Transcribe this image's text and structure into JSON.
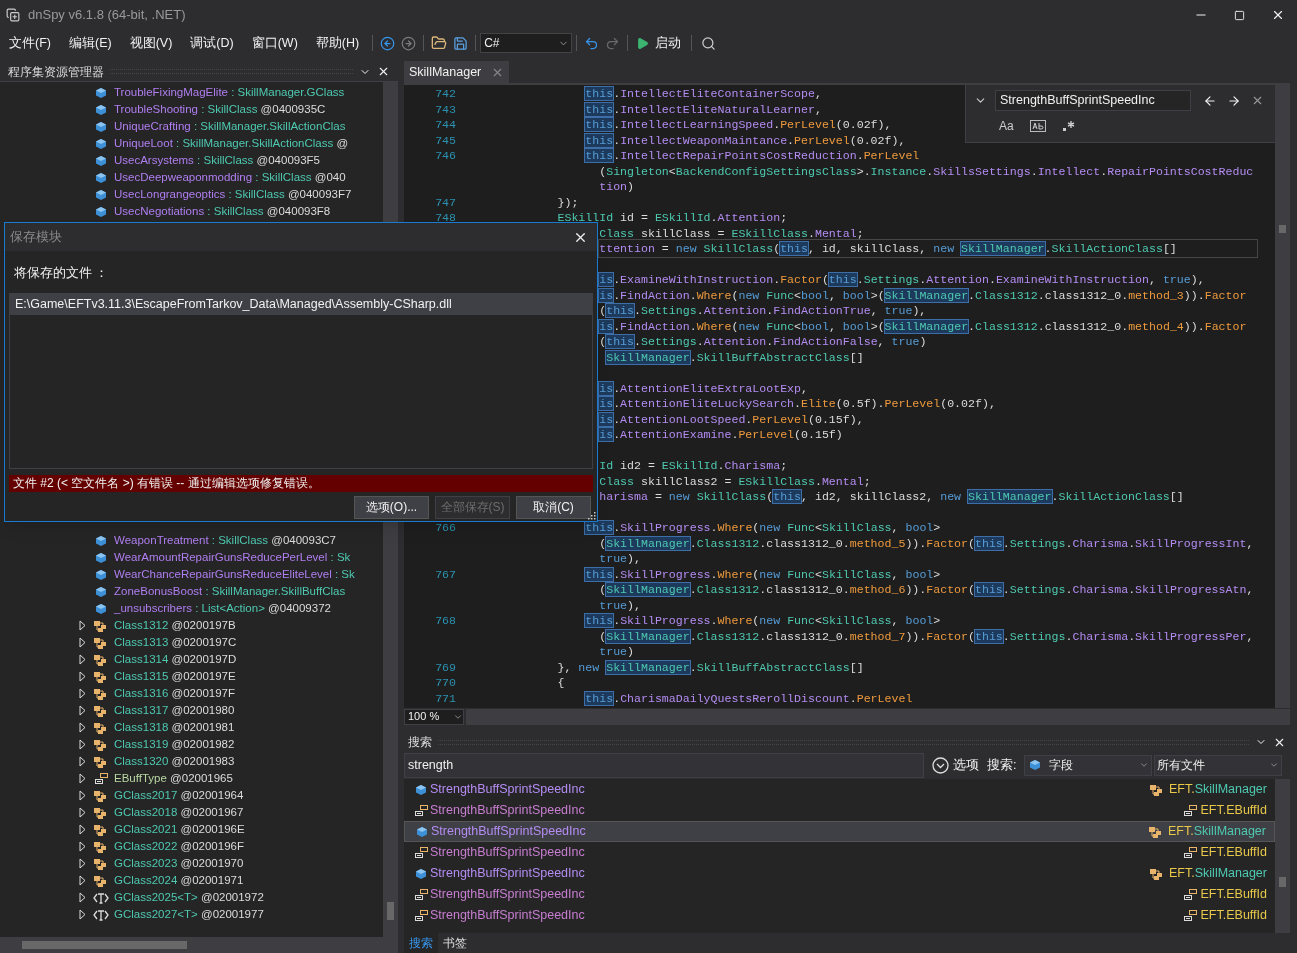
{
  "window": {
    "title": "dnSpy v6.1.8 (64-bit, .NET)"
  },
  "menu": [
    "文件(F)",
    "编辑(E)",
    "视图(V)",
    "调试(D)",
    "窗口(W)",
    "帮助(H)"
  ],
  "toolbar": {
    "language": "C#",
    "run_label": "启动"
  },
  "assembly_explorer": {
    "title": "程序集资源管理器",
    "items_top": [
      {
        "kind": "field",
        "name": "TroubleFixingMagElite",
        "type": ": SkillManager.GClass"
      },
      {
        "kind": "field",
        "name": "TroubleShooting",
        "type": ": SkillClass",
        "token": "@0400935C"
      },
      {
        "kind": "field",
        "name": "UniqueCrafting",
        "type": ": SkillManager.SkillActionClas"
      },
      {
        "kind": "field",
        "name": "UniqueLoot",
        "type": ": SkillManager.SkillActionClass",
        "token": "@"
      },
      {
        "kind": "field",
        "name": "UsecArsystems",
        "type": ": SkillClass",
        "token": "@040093F5"
      },
      {
        "kind": "field",
        "name": "UsecDeepweaponmodding",
        "type": ": SkillClass",
        "token": "@040"
      },
      {
        "kind": "field",
        "name": "UsecLongrangeoptics",
        "type": ": SkillClass",
        "token": "@040093F7"
      },
      {
        "kind": "field",
        "name": "UsecNegotiations",
        "type": ": SkillClass",
        "token": "@040093F8"
      }
    ],
    "items_bottom": [
      {
        "kind": "field",
        "name": "WeaponTreatment",
        "type": ": SkillClass",
        "token": "@040093C7"
      },
      {
        "kind": "field",
        "name": "WearAmountRepairGunsReducePerLevel",
        "type": ": Sk"
      },
      {
        "kind": "field",
        "name": "WearChanceRepairGunsReduceEliteLevel",
        "type": ": Sk"
      },
      {
        "kind": "field",
        "name": "ZoneBonusBoost",
        "type": ": SkillManager.SkillBuffClas"
      },
      {
        "kind": "field",
        "name": "_unsubscribers",
        "type": ": List<Action>",
        "token": "@04009372"
      },
      {
        "kind": "class",
        "name": "Class1312",
        "token": "@0200197B",
        "expanded": false
      },
      {
        "kind": "class",
        "name": "Class1313",
        "token": "@0200197C",
        "expanded": false
      },
      {
        "kind": "class",
        "name": "Class1314",
        "token": "@0200197D",
        "expanded": false
      },
      {
        "kind": "class",
        "name": "Class1315",
        "token": "@0200197E",
        "expanded": false
      },
      {
        "kind": "class",
        "name": "Class1316",
        "token": "@0200197F",
        "expanded": false
      },
      {
        "kind": "class",
        "name": "Class1317",
        "token": "@02001980",
        "expanded": false
      },
      {
        "kind": "class",
        "name": "Class1318",
        "token": "@02001981",
        "expanded": false
      },
      {
        "kind": "class",
        "name": "Class1319",
        "token": "@02001982",
        "expanded": false
      },
      {
        "kind": "class",
        "name": "Class1320",
        "token": "@02001983",
        "expanded": false
      },
      {
        "kind": "enum",
        "name": "EBuffType",
        "token": "@02001965",
        "expanded": false
      },
      {
        "kind": "class",
        "name": "GClass2017",
        "token": "@02001964",
        "expanded": false
      },
      {
        "kind": "class",
        "name": "GClass2018",
        "token": "@02001967",
        "expanded": false
      },
      {
        "kind": "class",
        "name": "GClass2021",
        "token": "@0200196E",
        "expanded": false
      },
      {
        "kind": "class",
        "name": "GClass2022",
        "token": "@0200196F",
        "expanded": false
      },
      {
        "kind": "class",
        "name": "GClass2023",
        "token": "@02001970",
        "expanded": false
      },
      {
        "kind": "class",
        "name": "GClass2024",
        "token": "@02001971",
        "expanded": false
      },
      {
        "kind": "generic",
        "name": "GClass2025<T>",
        "token": "@02001972",
        "expanded": false
      },
      {
        "kind": "generic",
        "name": "GClass2027<T>",
        "token": "@02001977",
        "expanded": false
      }
    ]
  },
  "editor": {
    "tab": {
      "label": "SkillManager",
      "selected": true
    },
    "find": {
      "query": "StrengthBuffSprintSpeedInc",
      "options": [
        {
          "kind": "case",
          "label": "Aa",
          "on": false
        },
        {
          "kind": "word",
          "on": false
        },
        {
          "kind": "regex",
          "on": false
        }
      ]
    },
    "zoom": "100 %",
    "lines": [
      {
        "kind": "inner",
        "number": "742",
        "current": false,
        "tokens": [
          {
            "kind": "this",
            "text": "this"
          },
          {
            "kind": "plain",
            "text": "."
          },
          {
            "kind": "member",
            "text": "IntellectEliteContainerScope"
          },
          {
            "kind": "plain",
            "text": ","
          }
        ]
      },
      {
        "kind": "inner",
        "number": "743",
        "current": false,
        "tokens": [
          {
            "kind": "this",
            "text": "this"
          },
          {
            "kind": "plain",
            "text": "."
          },
          {
            "kind": "member",
            "text": "IntellectEliteNaturalLearner"
          },
          {
            "kind": "plain",
            "text": ","
          }
        ]
      },
      {
        "kind": "inner",
        "number": "744",
        "current": false,
        "tokens": [
          {
            "kind": "this",
            "text": "this"
          },
          {
            "kind": "plain",
            "text": "."
          },
          {
            "kind": "member",
            "text": "IntellectLearningSpeed"
          },
          {
            "kind": "plain",
            "text": "."
          },
          {
            "kind": "method",
            "text": "PerLevel"
          },
          {
            "kind": "plain",
            "text": "(0.02f),"
          }
        ]
      },
      {
        "kind": "inner",
        "number": "745",
        "current": false,
        "tokens": [
          {
            "kind": "this",
            "text": "this"
          },
          {
            "kind": "plain",
            "text": "."
          },
          {
            "kind": "member",
            "text": "IntellectWeaponMaintance"
          },
          {
            "kind": "plain",
            "text": "."
          },
          {
            "kind": "method",
            "text": "PerLevel"
          },
          {
            "kind": "plain",
            "text": "(0.02f),"
          }
        ]
      },
      {
        "kind": "inner",
        "number": "746",
        "current": false,
        "tokens": [
          {
            "kind": "this",
            "text": "this"
          },
          {
            "kind": "plain",
            "text": "."
          },
          {
            "kind": "member",
            "text": "IntellectRepairPointsCostReduction"
          },
          {
            "kind": "plain",
            "text": "."
          },
          {
            "kind": "method",
            "text": "PerLevel"
          }
        ]
      },
      {
        "kind": "wrap",
        "current": false,
        "tokens": [
          {
            "kind": "plain",
            "text": "("
          },
          {
            "kind": "type",
            "text": "Singleton"
          },
          {
            "kind": "plain",
            "text": "<"
          },
          {
            "kind": "type",
            "text": "BackendConfigSettingsClass"
          },
          {
            "kind": "plain",
            "text": ">."
          },
          {
            "kind": "type",
            "text": "Instance"
          },
          {
            "kind": "plain",
            "text": "."
          },
          {
            "kind": "member",
            "text": "SkillsSettings"
          },
          {
            "kind": "plain",
            "text": "."
          },
          {
            "kind": "member",
            "text": "Intellect"
          },
          {
            "kind": "plain",
            "text": "."
          },
          {
            "kind": "member",
            "text": "RepairPointsCostReduc"
          }
        ]
      },
      {
        "kind": "wrap",
        "current": false,
        "tokens": [
          {
            "kind": "member",
            "text": "tion"
          },
          {
            "kind": "plain",
            "text": ")"
          }
        ]
      },
      {
        "kind": "outer",
        "number": "747",
        "current": false,
        "tokens": [
          {
            "kind": "plain",
            "text": "});"
          }
        ]
      },
      {
        "kind": "outer",
        "number": "748",
        "current": false,
        "tokens": [
          {
            "kind": "type",
            "text": "ESkillId"
          },
          {
            "kind": "plain",
            "text": " id = "
          },
          {
            "kind": "type",
            "text": "ESkillId"
          },
          {
            "kind": "plain",
            "text": "."
          },
          {
            "kind": "member",
            "text": "Attention"
          },
          {
            "kind": "plain",
            "text": ";"
          }
        ]
      },
      {
        "kind": "wrap",
        "current": false,
        "tokens": [
          {
            "kind": "type",
            "text": "Class"
          },
          {
            "kind": "plain",
            "text": " skillClass = "
          },
          {
            "kind": "type",
            "text": "ESkillClass"
          },
          {
            "kind": "plain",
            "text": "."
          },
          {
            "kind": "member",
            "text": "Mental"
          },
          {
            "kind": "plain",
            "text": ";"
          }
        ]
      },
      {
        "kind": "wrap",
        "current": true,
        "tokens": [
          {
            "kind": "member",
            "text": "ttention"
          },
          {
            "kind": "plain",
            "text": " = "
          },
          {
            "kind": "keyword",
            "text": "new "
          },
          {
            "kind": "type",
            "text": "SkillClass"
          },
          {
            "kind": "plain",
            "text": "("
          },
          {
            "kind": "this",
            "text": "this"
          },
          {
            "kind": "plain",
            "text": ", id, skillClass, "
          },
          {
            "kind": "keyword",
            "text": "new "
          },
          {
            "kind": "typeref",
            "text": "SkillManager"
          },
          {
            "kind": "plain",
            "text": "."
          },
          {
            "kind": "type",
            "text": "SkillActionClass"
          },
          {
            "kind": "plain",
            "text": "[]"
          }
        ]
      },
      {
        "kind": "blank"
      },
      {
        "kind": "wrap",
        "current": false,
        "tokens": [
          {
            "kind": "this",
            "text": "is"
          },
          {
            "kind": "plain",
            "text": "."
          },
          {
            "kind": "member",
            "text": "ExamineWithInstruction"
          },
          {
            "kind": "plain",
            "text": "."
          },
          {
            "kind": "method",
            "text": "Factor"
          },
          {
            "kind": "plain",
            "text": "("
          },
          {
            "kind": "this",
            "text": "this"
          },
          {
            "kind": "plain",
            "text": "."
          },
          {
            "kind": "type",
            "text": "Settings"
          },
          {
            "kind": "plain",
            "text": "."
          },
          {
            "kind": "member",
            "text": "Attention"
          },
          {
            "kind": "plain",
            "text": "."
          },
          {
            "kind": "member",
            "text": "ExamineWithInstruction"
          },
          {
            "kind": "plain",
            "text": ", "
          },
          {
            "kind": "keyword",
            "text": "true"
          },
          {
            "kind": "plain",
            "text": "),"
          }
        ]
      },
      {
        "kind": "wrap",
        "current": false,
        "tokens": [
          {
            "kind": "this",
            "text": "is"
          },
          {
            "kind": "plain",
            "text": "."
          },
          {
            "kind": "member",
            "text": "FindAction"
          },
          {
            "kind": "plain",
            "text": "."
          },
          {
            "kind": "method",
            "text": "Where"
          },
          {
            "kind": "plain",
            "text": "("
          },
          {
            "kind": "keyword",
            "text": "new "
          },
          {
            "kind": "type",
            "text": "Func"
          },
          {
            "kind": "plain",
            "text": "<"
          },
          {
            "kind": "keyword",
            "text": "bool"
          },
          {
            "kind": "plain",
            "text": ", "
          },
          {
            "kind": "keyword",
            "text": "bool"
          },
          {
            "kind": "plain",
            "text": ">("
          },
          {
            "kind": "typeref",
            "text": "SkillManager"
          },
          {
            "kind": "plain",
            "text": "."
          },
          {
            "kind": "type",
            "text": "Class1312"
          },
          {
            "kind": "plain",
            "text": ".class1312_0."
          },
          {
            "kind": "method",
            "text": "method_3"
          },
          {
            "kind": "plain",
            "text": "))."
          },
          {
            "kind": "method",
            "text": "Factor"
          }
        ]
      },
      {
        "kind": "wrap",
        "current": false,
        "tokens": [
          {
            "kind": "plain",
            "text": "("
          },
          {
            "kind": "this",
            "text": "this"
          },
          {
            "kind": "plain",
            "text": "."
          },
          {
            "kind": "type",
            "text": "Settings"
          },
          {
            "kind": "plain",
            "text": "."
          },
          {
            "kind": "member",
            "text": "Attention"
          },
          {
            "kind": "plain",
            "text": "."
          },
          {
            "kind": "member",
            "text": "FindActionTrue"
          },
          {
            "kind": "plain",
            "text": ", "
          },
          {
            "kind": "keyword",
            "text": "true"
          },
          {
            "kind": "plain",
            "text": "),"
          }
        ]
      },
      {
        "kind": "wrap",
        "current": false,
        "tokens": [
          {
            "kind": "this",
            "text": "is"
          },
          {
            "kind": "plain",
            "text": "."
          },
          {
            "kind": "member",
            "text": "FindAction"
          },
          {
            "kind": "plain",
            "text": "."
          },
          {
            "kind": "method",
            "text": "Where"
          },
          {
            "kind": "plain",
            "text": "("
          },
          {
            "kind": "keyword",
            "text": "new "
          },
          {
            "kind": "type",
            "text": "Func"
          },
          {
            "kind": "plain",
            "text": "<"
          },
          {
            "kind": "keyword",
            "text": "bool"
          },
          {
            "kind": "plain",
            "text": ", "
          },
          {
            "kind": "keyword",
            "text": "bool"
          },
          {
            "kind": "plain",
            "text": ">("
          },
          {
            "kind": "typeref",
            "text": "SkillManager"
          },
          {
            "kind": "plain",
            "text": "."
          },
          {
            "kind": "type",
            "text": "Class1312"
          },
          {
            "kind": "plain",
            "text": ".class1312_0."
          },
          {
            "kind": "method",
            "text": "method_4"
          },
          {
            "kind": "plain",
            "text": "))."
          },
          {
            "kind": "method",
            "text": "Factor"
          }
        ]
      },
      {
        "kind": "wrap",
        "current": false,
        "tokens": [
          {
            "kind": "plain",
            "text": "("
          },
          {
            "kind": "this",
            "text": "this"
          },
          {
            "kind": "plain",
            "text": "."
          },
          {
            "kind": "type",
            "text": "Settings"
          },
          {
            "kind": "plain",
            "text": "."
          },
          {
            "kind": "member",
            "text": "Attention"
          },
          {
            "kind": "plain",
            "text": "."
          },
          {
            "kind": "member",
            "text": "FindActionFalse"
          },
          {
            "kind": "plain",
            "text": ", "
          },
          {
            "kind": "keyword",
            "text": "true"
          },
          {
            "kind": "plain",
            "text": ")"
          }
        ]
      },
      {
        "kind": "wrap_extra",
        "current": false,
        "tokens": [
          {
            "kind": "typeref",
            "text": "SkillManager"
          },
          {
            "kind": "plain",
            "text": "."
          },
          {
            "kind": "type",
            "text": "SkillBuffAbstractClass"
          },
          {
            "kind": "plain",
            "text": "[]"
          }
        ]
      },
      {
        "kind": "blank"
      },
      {
        "kind": "wrap",
        "current": false,
        "tokens": [
          {
            "kind": "this",
            "text": "is"
          },
          {
            "kind": "plain",
            "text": "."
          },
          {
            "kind": "member",
            "text": "AttentionEliteExtraLootExp"
          },
          {
            "kind": "plain",
            "text": ","
          }
        ]
      },
      {
        "kind": "wrap",
        "current": false,
        "tokens": [
          {
            "kind": "this",
            "text": "is"
          },
          {
            "kind": "plain",
            "text": "."
          },
          {
            "kind": "member",
            "text": "AttentionEliteLuckySearch"
          },
          {
            "kind": "plain",
            "text": "."
          },
          {
            "kind": "method",
            "text": "Elite"
          },
          {
            "kind": "plain",
            "text": "(0.5f)."
          },
          {
            "kind": "method",
            "text": "PerLevel"
          },
          {
            "kind": "plain",
            "text": "(0.02f),"
          }
        ]
      },
      {
        "kind": "wrap",
        "current": false,
        "tokens": [
          {
            "kind": "this",
            "text": "is"
          },
          {
            "kind": "plain",
            "text": "."
          },
          {
            "kind": "member",
            "text": "AttentionLootSpeed"
          },
          {
            "kind": "plain",
            "text": "."
          },
          {
            "kind": "method",
            "text": "PerLevel"
          },
          {
            "kind": "plain",
            "text": "(0.15f),"
          }
        ]
      },
      {
        "kind": "wrap",
        "current": false,
        "tokens": [
          {
            "kind": "this",
            "text": "is"
          },
          {
            "kind": "plain",
            "text": "."
          },
          {
            "kind": "member",
            "text": "AttentionExamine"
          },
          {
            "kind": "plain",
            "text": "."
          },
          {
            "kind": "method",
            "text": "PerLevel"
          },
          {
            "kind": "plain",
            "text": "(0.15f)"
          }
        ]
      },
      {
        "kind": "blank"
      },
      {
        "kind": "wrap",
        "current": false,
        "tokens": [
          {
            "kind": "type",
            "text": "Id"
          },
          {
            "kind": "plain",
            "text": " id2 = "
          },
          {
            "kind": "type",
            "text": "ESkillId"
          },
          {
            "kind": "plain",
            "text": "."
          },
          {
            "kind": "member",
            "text": "Charisma"
          },
          {
            "kind": "plain",
            "text": ";"
          }
        ]
      },
      {
        "kind": "wrap",
        "current": false,
        "tokens": [
          {
            "kind": "type",
            "text": "Class"
          },
          {
            "kind": "plain",
            "text": " skillClass2 = "
          },
          {
            "kind": "type",
            "text": "ESkillClass"
          },
          {
            "kind": "plain",
            "text": "."
          },
          {
            "kind": "member",
            "text": "Mental"
          },
          {
            "kind": "plain",
            "text": ";"
          }
        ]
      },
      {
        "kind": "wrap",
        "current": false,
        "tokens": [
          {
            "kind": "member",
            "text": "harisma"
          },
          {
            "kind": "plain",
            "text": " = "
          },
          {
            "kind": "keyword",
            "text": "new "
          },
          {
            "kind": "type",
            "text": "SkillClass"
          },
          {
            "kind": "plain",
            "text": "("
          },
          {
            "kind": "this",
            "text": "this"
          },
          {
            "kind": "plain",
            "text": ", id2, skillClass2, "
          },
          {
            "kind": "keyword",
            "text": "new "
          },
          {
            "kind": "typeref",
            "text": "SkillManager"
          },
          {
            "kind": "plain",
            "text": "."
          },
          {
            "kind": "type",
            "text": "SkillActionClass"
          },
          {
            "kind": "plain",
            "text": "[]"
          }
        ]
      },
      {
        "kind": "blank"
      },
      {
        "kind": "inner",
        "number": "766",
        "current": false,
        "tokens": [
          {
            "kind": "this",
            "text": "this"
          },
          {
            "kind": "plain",
            "text": "."
          },
          {
            "kind": "member",
            "text": "SkillProgress"
          },
          {
            "kind": "plain",
            "text": "."
          },
          {
            "kind": "method",
            "text": "Where"
          },
          {
            "kind": "plain",
            "text": "("
          },
          {
            "kind": "keyword",
            "text": "new "
          },
          {
            "kind": "type",
            "text": "Func"
          },
          {
            "kind": "plain",
            "text": "<"
          },
          {
            "kind": "type",
            "text": "SkillClass"
          },
          {
            "kind": "plain",
            "text": ", "
          },
          {
            "kind": "keyword",
            "text": "bool"
          },
          {
            "kind": "plain",
            "text": ">"
          }
        ]
      },
      {
        "kind": "wrap",
        "current": false,
        "tokens": [
          {
            "kind": "plain",
            "text": "("
          },
          {
            "kind": "typeref",
            "text": "SkillManager"
          },
          {
            "kind": "plain",
            "text": "."
          },
          {
            "kind": "type",
            "text": "Class1312"
          },
          {
            "kind": "plain",
            "text": ".class1312_0."
          },
          {
            "kind": "method",
            "text": "method_5"
          },
          {
            "kind": "plain",
            "text": "))."
          },
          {
            "kind": "method",
            "text": "Factor"
          },
          {
            "kind": "plain",
            "text": "("
          },
          {
            "kind": "this",
            "text": "this"
          },
          {
            "kind": "plain",
            "text": "."
          },
          {
            "kind": "type",
            "text": "Settings"
          },
          {
            "kind": "plain",
            "text": "."
          },
          {
            "kind": "member",
            "text": "Charisma"
          },
          {
            "kind": "plain",
            "text": "."
          },
          {
            "kind": "member",
            "text": "SkillProgressInt"
          },
          {
            "kind": "plain",
            "text": ","
          }
        ]
      },
      {
        "kind": "wrap",
        "current": false,
        "tokens": [
          {
            "kind": "keyword",
            "text": "true"
          },
          {
            "kind": "plain",
            "text": "),"
          }
        ]
      },
      {
        "kind": "inner",
        "number": "767",
        "current": false,
        "tokens": [
          {
            "kind": "this",
            "text": "this"
          },
          {
            "kind": "plain",
            "text": "."
          },
          {
            "kind": "member",
            "text": "SkillProgress"
          },
          {
            "kind": "plain",
            "text": "."
          },
          {
            "kind": "method",
            "text": "Where"
          },
          {
            "kind": "plain",
            "text": "("
          },
          {
            "kind": "keyword",
            "text": "new "
          },
          {
            "kind": "type",
            "text": "Func"
          },
          {
            "kind": "plain",
            "text": "<"
          },
          {
            "kind": "type",
            "text": "SkillClass"
          },
          {
            "kind": "plain",
            "text": ", "
          },
          {
            "kind": "keyword",
            "text": "bool"
          },
          {
            "kind": "plain",
            "text": ">"
          }
        ]
      },
      {
        "kind": "wrap",
        "current": false,
        "tokens": [
          {
            "kind": "plain",
            "text": "("
          },
          {
            "kind": "typeref",
            "text": "SkillManager"
          },
          {
            "kind": "plain",
            "text": "."
          },
          {
            "kind": "type",
            "text": "Class1312"
          },
          {
            "kind": "plain",
            "text": ".class1312_0."
          },
          {
            "kind": "method",
            "text": "method_6"
          },
          {
            "kind": "plain",
            "text": "))."
          },
          {
            "kind": "method",
            "text": "Factor"
          },
          {
            "kind": "plain",
            "text": "("
          },
          {
            "kind": "this",
            "text": "this"
          },
          {
            "kind": "plain",
            "text": "."
          },
          {
            "kind": "type",
            "text": "Settings"
          },
          {
            "kind": "plain",
            "text": "."
          },
          {
            "kind": "member",
            "text": "Charisma"
          },
          {
            "kind": "plain",
            "text": "."
          },
          {
            "kind": "member",
            "text": "SkillProgressAtn"
          },
          {
            "kind": "plain",
            "text": ","
          }
        ]
      },
      {
        "kind": "wrap",
        "current": false,
        "tokens": [
          {
            "kind": "keyword",
            "text": "true"
          },
          {
            "kind": "plain",
            "text": "),"
          }
        ]
      },
      {
        "kind": "inner",
        "number": "768",
        "current": false,
        "tokens": [
          {
            "kind": "this",
            "text": "this"
          },
          {
            "kind": "plain",
            "text": "."
          },
          {
            "kind": "member",
            "text": "SkillProgress"
          },
          {
            "kind": "plain",
            "text": "."
          },
          {
            "kind": "method",
            "text": "Where"
          },
          {
            "kind": "plain",
            "text": "("
          },
          {
            "kind": "keyword",
            "text": "new "
          },
          {
            "kind": "type",
            "text": "Func"
          },
          {
            "kind": "plain",
            "text": "<"
          },
          {
            "kind": "type",
            "text": "SkillClass"
          },
          {
            "kind": "plain",
            "text": ", "
          },
          {
            "kind": "keyword",
            "text": "bool"
          },
          {
            "kind": "plain",
            "text": ">"
          }
        ]
      },
      {
        "kind": "wrap",
        "current": false,
        "tokens": [
          {
            "kind": "plain",
            "text": "("
          },
          {
            "kind": "typeref",
            "text": "SkillManager"
          },
          {
            "kind": "plain",
            "text": "."
          },
          {
            "kind": "type",
            "text": "Class1312"
          },
          {
            "kind": "plain",
            "text": ".class1312_0."
          },
          {
            "kind": "method",
            "text": "method_7"
          },
          {
            "kind": "plain",
            "text": "))."
          },
          {
            "kind": "method",
            "text": "Factor"
          },
          {
            "kind": "plain",
            "text": "("
          },
          {
            "kind": "this",
            "text": "this"
          },
          {
            "kind": "plain",
            "text": "."
          },
          {
            "kind": "type",
            "text": "Settings"
          },
          {
            "kind": "plain",
            "text": "."
          },
          {
            "kind": "member",
            "text": "Charisma"
          },
          {
            "kind": "plain",
            "text": "."
          },
          {
            "kind": "member",
            "text": "SkillProgressPer"
          },
          {
            "kind": "plain",
            "text": ","
          }
        ]
      },
      {
        "kind": "wrap",
        "current": false,
        "tokens": [
          {
            "kind": "keyword",
            "text": "true"
          },
          {
            "kind": "plain",
            "text": ")"
          }
        ]
      },
      {
        "kind": "outer",
        "number": "769",
        "current": false,
        "tokens": [
          {
            "kind": "plain",
            "text": "}, "
          },
          {
            "kind": "keyword",
            "text": "new "
          },
          {
            "kind": "typeref",
            "text": "SkillManager"
          },
          {
            "kind": "plain",
            "text": "."
          },
          {
            "kind": "type",
            "text": "SkillBuffAbstractClass"
          },
          {
            "kind": "plain",
            "text": "[]"
          }
        ]
      },
      {
        "kind": "outer",
        "number": "770",
        "current": false,
        "tokens": [
          {
            "kind": "plain",
            "text": "{"
          }
        ]
      },
      {
        "kind": "inner",
        "number": "771",
        "current": false,
        "tokens": [
          {
            "kind": "this",
            "text": "this"
          },
          {
            "kind": "plain",
            "text": "."
          },
          {
            "kind": "member",
            "text": "CharismaDailyQuestsRerollDiscount"
          },
          {
            "kind": "plain",
            "text": "."
          },
          {
            "kind": "method",
            "text": "PerLevel"
          }
        ]
      }
    ]
  },
  "search": {
    "title": "搜索",
    "query": "strength",
    "options_label": "选项",
    "search_label": "搜索:",
    "scope": "字段",
    "location": "所有文件",
    "results": [
      {
        "kind": "field",
        "name": "StrengthBuffSprintSpeedInc",
        "owner": {
          "kind": "class",
          "namespace": "EFT.",
          "name": "SkillManager"
        },
        "selected": false
      },
      {
        "kind": "enum_value",
        "name": "StrengthBuffSprintSpeedInc",
        "owner": {
          "kind": "enum",
          "namespace": "EFT.",
          "name": "EBuffId"
        },
        "selected": false
      },
      {
        "kind": "field",
        "name": "StrengthBuffSprintSpeedInc",
        "owner": {
          "kind": "class",
          "namespace": "EFT.",
          "name": "SkillManager"
        },
        "selected": true
      },
      {
        "kind": "enum_value",
        "name": "StrengthBuffSprintSpeedInc",
        "owner": {
          "kind": "enum",
          "namespace": "EFT.",
          "name": "EBuffId"
        },
        "selected": false
      },
      {
        "kind": "field",
        "name": "StrengthBuffSprintSpeedInc",
        "owner": {
          "kind": "class",
          "namespace": "EFT.",
          "name": "SkillManager"
        },
        "selected": false
      },
      {
        "kind": "enum_value",
        "name": "StrengthBuffSprintSpeedInc",
        "owner": {
          "kind": "enum",
          "namespace": "EFT.",
          "name": "EBuffId"
        },
        "selected": false
      },
      {
        "kind": "enum_value",
        "name": "StrengthBuffSprintSpeedInc",
        "owner": {
          "kind": "enum",
          "namespace": "EFT.",
          "name": "EBuffId"
        },
        "selected": false
      }
    ],
    "tabs": [
      {
        "label": "搜索",
        "selected": true
      },
      {
        "label": "书签",
        "selected": false
      }
    ]
  },
  "dialog": {
    "title": "保存模块",
    "files_label": "将保存的文件 ：",
    "files": [
      {
        "path": "E:\\Game\\EFTv3.11.3\\EscapeFromTarkov_Data\\Managed\\Assembly-CSharp.dll",
        "selected": true
      }
    ],
    "error": "文件 #2 (< 空文件名 >) 有错误 -- 通过编辑选项修复错误。",
    "buttons": [
      {
        "label": "选项(O)...",
        "disabled": false
      },
      {
        "label": "全部保存(S)",
        "disabled": true
      },
      {
        "label": "取消(C)",
        "disabled": false
      }
    ]
  }
}
